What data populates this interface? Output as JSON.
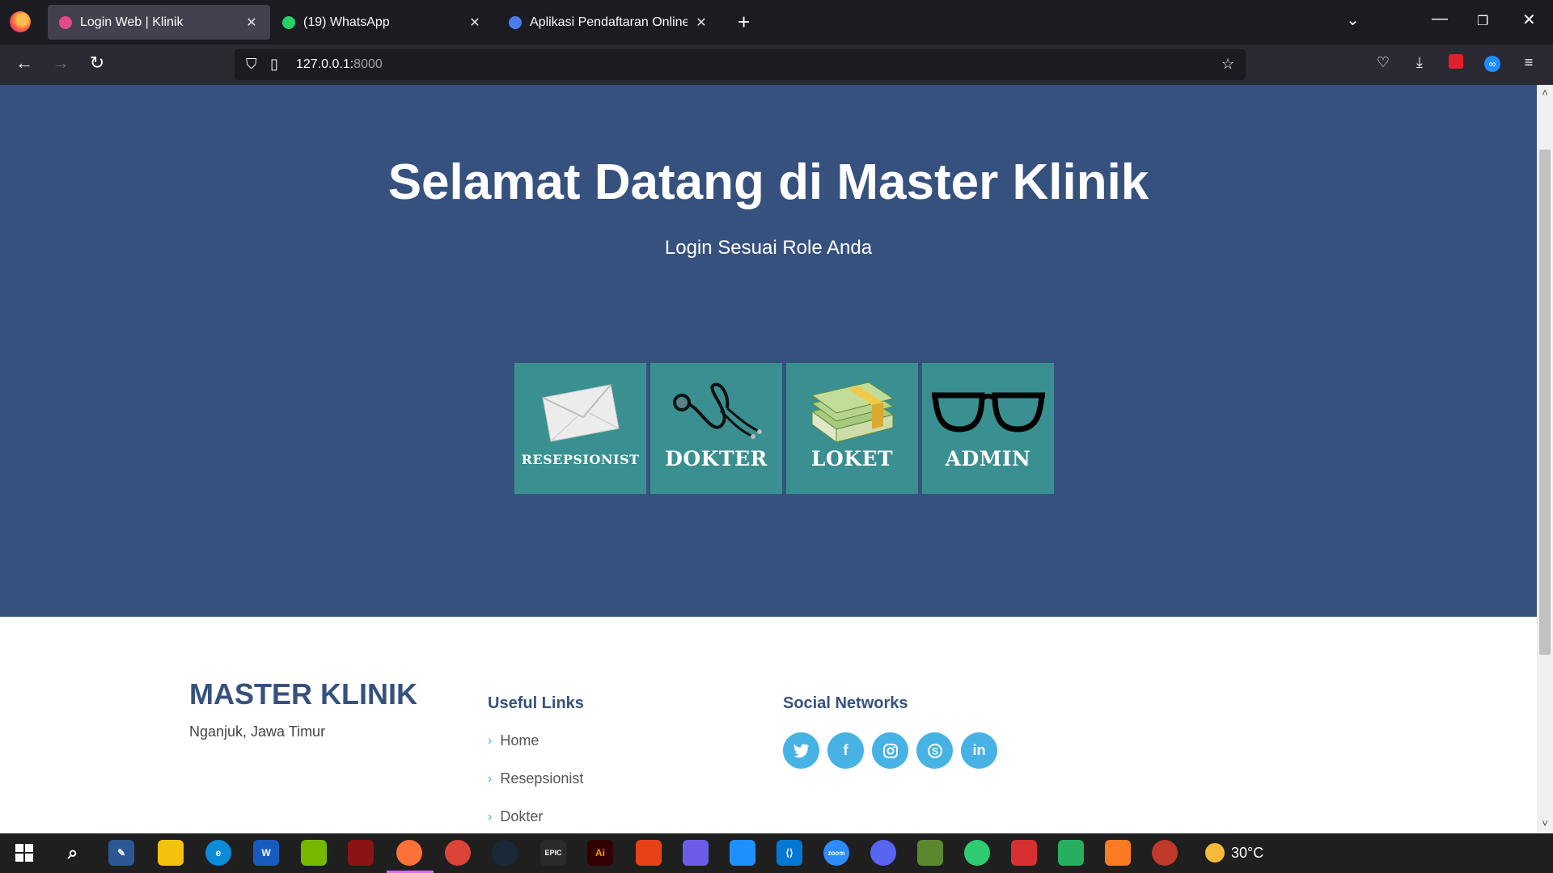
{
  "browser": {
    "tabs": [
      {
        "title": "Login Web | Klinik",
        "active": true,
        "icon_color": "#e24b8a"
      },
      {
        "title": "(19) WhatsApp",
        "active": false,
        "icon_color": "#25d366",
        "badge": "19"
      },
      {
        "title": "Aplikasi Pendaftaran Online Klin",
        "active": false,
        "icon_color": "#4b7bec"
      }
    ],
    "url_host": "127.0.0.1:",
    "url_port": "8000"
  },
  "hero": {
    "title": "Selamat Datang di Master Klinik",
    "subtitle": "Login Sesuai Role Anda",
    "roles": [
      {
        "label": "RESEPSIONIST",
        "icon": "envelope-icon"
      },
      {
        "label": "DOKTER",
        "icon": "stethoscope-icon"
      },
      {
        "label": "LOKET",
        "icon": "money-stack-icon"
      },
      {
        "label": "ADMIN",
        "icon": "glasses-icon"
      }
    ]
  },
  "footer": {
    "brand": "MASTER KLINIK",
    "address": "Nganjuk, Jawa Timur",
    "useful_links_heading": "Useful Links",
    "links": [
      "Home",
      "Resepsionist",
      "Dokter"
    ],
    "social_heading": "Social Networks",
    "socials": [
      "twitter-icon",
      "facebook-icon",
      "instagram-icon",
      "skype-icon",
      "linkedin-icon"
    ]
  },
  "taskbar": {
    "temperature": "30°C"
  },
  "colors": {
    "hero_bg": "#37517e",
    "role_tile": "#3a9090",
    "accent": "#47b2e4"
  }
}
